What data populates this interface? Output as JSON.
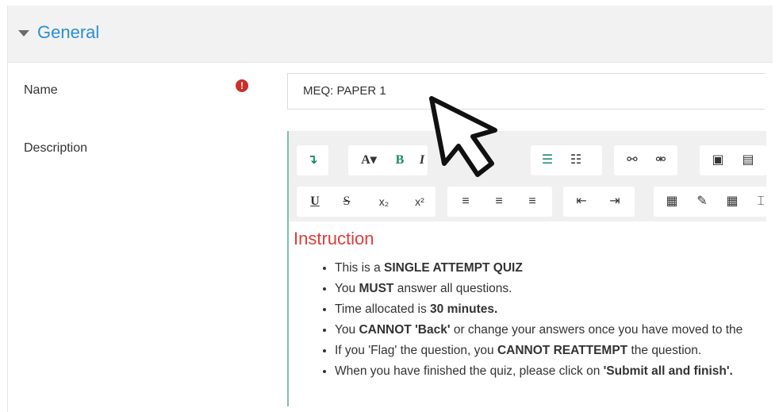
{
  "section": {
    "title": "General"
  },
  "form": {
    "name_label": "Name",
    "name_value": "MEQ: PAPER 1",
    "required_icon": "exclamation-circle-icon",
    "description_label": "Description"
  },
  "editor": {
    "heading": "Instruction",
    "items": [
      [
        "This is a ",
        "SINGLE ATTEMPT QUIZ",
        ""
      ],
      [
        "You ",
        "MUST",
        " answer all questions."
      ],
      [
        "Time allocated is ",
        "30 minutes.",
        ""
      ],
      [
        "You ",
        "CANNOT 'Back'",
        " or change your answers once you have moved to the"
      ],
      [
        "If you 'Flag' the question, you ",
        "CANNOT REATTEMPT",
        " the question."
      ],
      [
        "When you have finished the quiz, please click on ",
        "'Submit all and finish'.",
        ""
      ]
    ]
  },
  "colors": {
    "accent": "#2d8fd5",
    "heading_red": "#e03b3b",
    "editor_green": "#1a8a66"
  }
}
